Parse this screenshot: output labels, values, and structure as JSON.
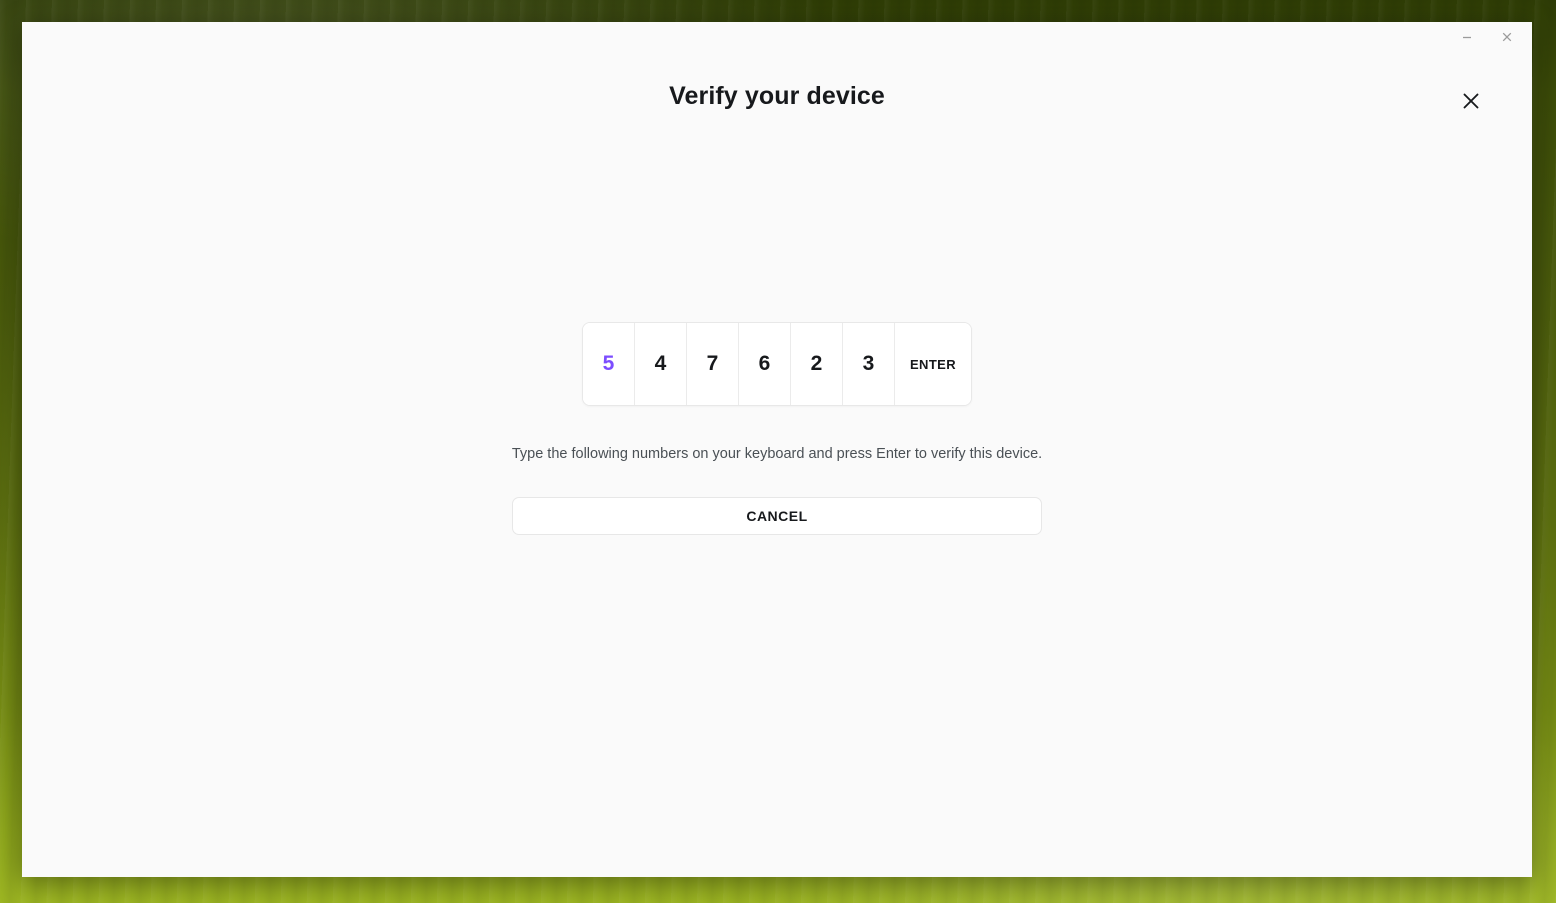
{
  "window": {
    "controls": {
      "minimize_label": "–",
      "minimize_icon": "minimize-icon",
      "close_label": "×",
      "close_icon": "close-icon"
    }
  },
  "dialog": {
    "title": "Verify your device",
    "close_icon": "close-icon",
    "instruction": "Type the following numbers on your keyboard and press Enter to verify this device.",
    "cancel_label": "CANCEL",
    "code": {
      "digits": [
        "5",
        "4",
        "7",
        "6",
        "2",
        "3"
      ],
      "current_index": 0,
      "enter_label": "ENTER",
      "highlight_color": "#7c4dff"
    }
  },
  "colors": {
    "accent": "#7c4dff",
    "text_primary": "#17191c",
    "text_secondary": "#4a5055",
    "panel_bg": "#fafafa",
    "cell_bg": "#ffffff",
    "border": "#e8e8e8",
    "desktop_green_dark": "#2f3d06",
    "desktop_green_light": "#9cb522"
  }
}
